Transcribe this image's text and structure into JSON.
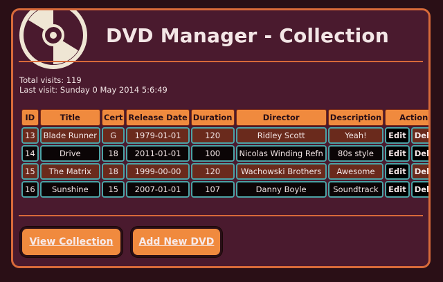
{
  "header": {
    "title": "DVD Manager - Collection"
  },
  "stats": {
    "total_visits": "Total visits: 119",
    "last_visit": "Last visit: Sunday 0 May 2014 5:6:49"
  },
  "table": {
    "headers": [
      "ID",
      "Title",
      "Cert",
      "Release Date",
      "Duration",
      "Director",
      "Description",
      "Actions"
    ],
    "rows": [
      {
        "id": "13",
        "title": "Blade Runner",
        "cert": "G",
        "release": "1979-01-01",
        "duration": "120",
        "director": "Ridley Scott",
        "description": "Yeah!",
        "edit": "Edit",
        "delete": "Delete"
      },
      {
        "id": "14",
        "title": "Drive",
        "cert": "18",
        "release": "2011-01-01",
        "duration": "100",
        "director": "Nicolas Winding Refn",
        "description": "80s style",
        "edit": "Edit",
        "delete": "Delete"
      },
      {
        "id": "15",
        "title": "The Matrix",
        "cert": "18",
        "release": "1999-00-00",
        "duration": "120",
        "director": "Wachowski Brothers",
        "description": "Awesome",
        "edit": "Edit",
        "delete": "Delete"
      },
      {
        "id": "16",
        "title": "Sunshine",
        "cert": "15",
        "release": "2007-01-01",
        "duration": "107",
        "director": "Danny Boyle",
        "description": "Soundtrack",
        "edit": "Edit",
        "delete": "Delete"
      }
    ]
  },
  "buttons": {
    "view": "View Collection",
    "add": "Add New DVD"
  },
  "colors": {
    "accent": "#f08a3e",
    "panel": "#4a1a2e",
    "background": "#2a0f16",
    "cell_border": "#4ca3a6"
  }
}
